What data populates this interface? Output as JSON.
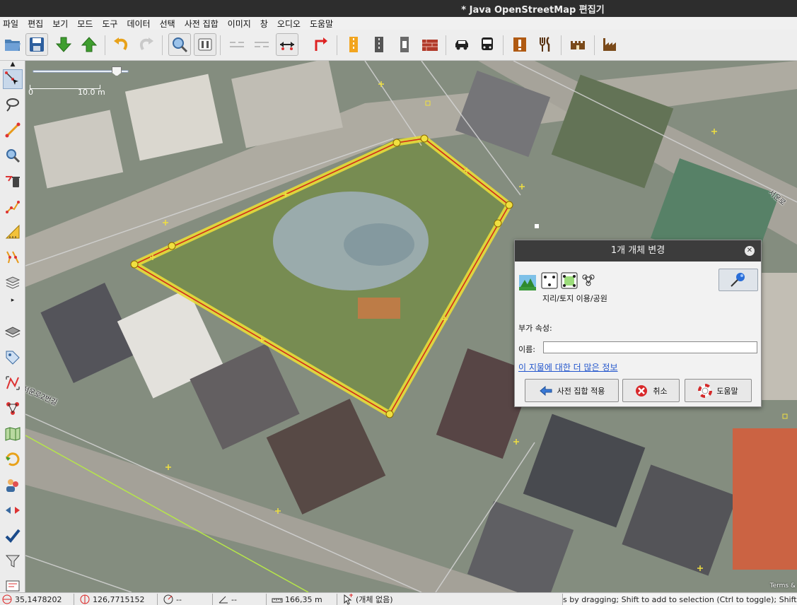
{
  "window": {
    "title": "* Java OpenStreetMap 편집기"
  },
  "menu": [
    "파일",
    "편집",
    "보기",
    "모드",
    "도구",
    "데이터",
    "선택",
    "사전 집합",
    "이미지",
    "창",
    "오디오",
    "도움말"
  ],
  "toolbar": {
    "icons": [
      "open-file-icon",
      "save-icon",
      "download-icon",
      "upload-icon",
      "undo-icon",
      "redo-icon",
      "zoom-icon",
      "preferences-icon",
      "split-way-icon",
      "combine-way-icon",
      "align-line-icon",
      "reverse-way-icon",
      "preset-road-icon",
      "preset-rail-icon",
      "preset-traffic-light-icon",
      "preset-wall-icon",
      "preset-car-icon",
      "preset-bus-icon",
      "preset-warning-icon",
      "preset-restaurant-icon",
      "preset-castle-icon",
      "preset-industrial-icon"
    ]
  },
  "leftbar": {
    "tools": [
      "select-tool-icon",
      "lasso-tool-icon",
      "draw-tool-icon",
      "zoom-tool-icon",
      "delete-tool-icon",
      "parallel-tool-icon",
      "measure-tool-icon",
      "improve-way-icon",
      "imagery-layers-icon",
      "layers-icon",
      "tags-icon",
      "selection-list-icon",
      "relations-icon",
      "map-paint-icon",
      "history-icon",
      "authors-icon",
      "conflict-icon",
      "validation-icon",
      "filter-icon",
      "note-icon"
    ]
  },
  "map": {
    "scale_start": "0",
    "scale_end": "10.0 m",
    "street_labels": [
      "서운로2번길",
      "서운로"
    ],
    "terms": "Terms &"
  },
  "dialog": {
    "title": "1개 개체 변경",
    "preset_name": "지리/토지 이용/공원",
    "extra_label": "부가 속성:",
    "name_label": "이름:",
    "name_value": "",
    "more_info_link": "이 지물에 대한 더 많은 정보",
    "apply_button": "사전 집합 적용",
    "cancel_button": "취소",
    "help_button": "도움말"
  },
  "statusbar": {
    "lat": "35,1478202",
    "lon": "126,7715152",
    "heading": "--",
    "angle": "--",
    "distance": "166,35 m",
    "selection": "(개체 없음)",
    "help_text": "s by dragging; Shift to add to selection (Ctrl to toggle); Shift+"
  },
  "colors": {
    "selection_fill": "#e8c84a",
    "selection_stroke": "#d22a1a",
    "title_bar": "#2d2d2d"
  }
}
